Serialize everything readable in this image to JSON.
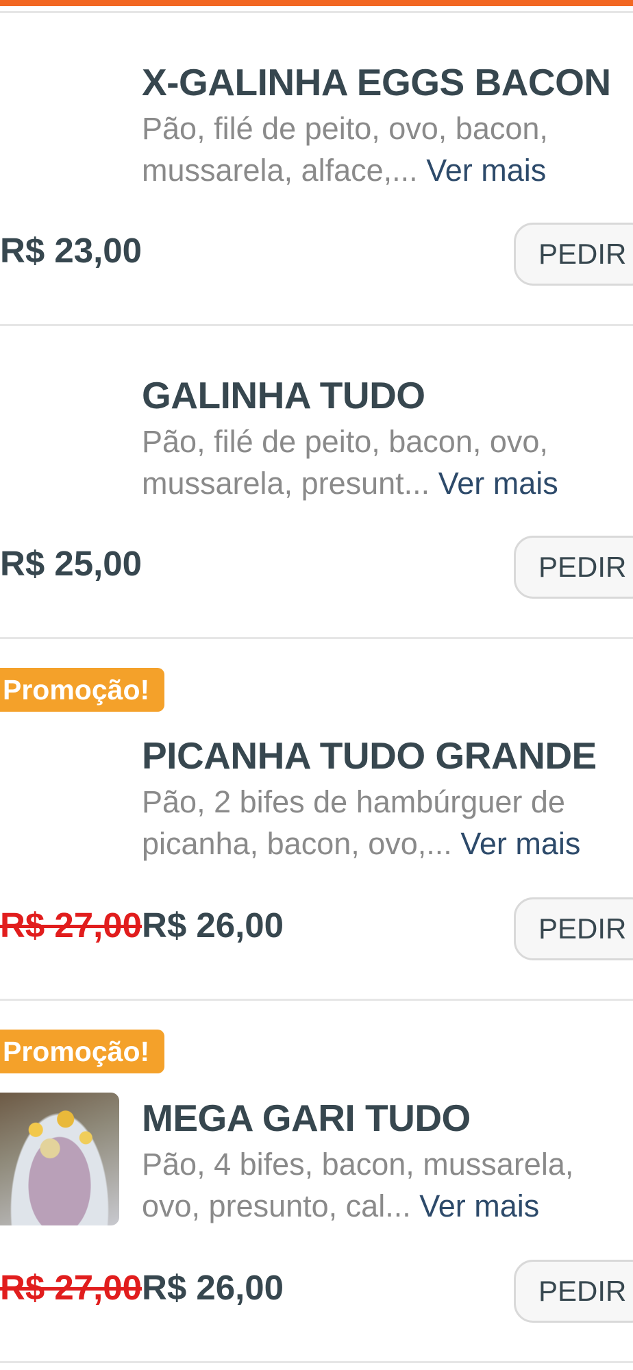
{
  "items": [
    {
      "title": "X-GALINHA EGGS BACON",
      "desc_line1": "Pão, filé de peito, ovo, bacon,",
      "desc_line2": "mussarela, alface,... ",
      "more": "Ver mais",
      "price": "R$ 23,00",
      "button": "PEDIR"
    },
    {
      "title": "GALINHA TUDO",
      "desc_line1": "Pão, filé de peito, bacon, ovo,",
      "desc_line2": "mussarela, presunt... ",
      "more": "Ver mais",
      "price": "R$ 25,00",
      "button": "PEDIR"
    },
    {
      "badge": "Promoção!",
      "title": "PICANHA TUDO GRANDE",
      "desc_line1": "Pão, 2 bifes de hambúrguer de",
      "desc_line2": "picanha, bacon, ovo,... ",
      "more": "Ver mais",
      "old_price": "R$ 27,00",
      "price": "R$ 26,00",
      "button": "PEDIR"
    },
    {
      "badge": "Promoção!",
      "title": "MEGA GARI TUDO",
      "desc_line1": "Pão, 4 bifes, bacon, mussarela,",
      "desc_line2": "ovo, presunto, cal... ",
      "more": "Ver mais",
      "old_price": "R$ 27,00",
      "price": "R$ 26,00",
      "button": "PEDIR"
    }
  ],
  "colors": {
    "accent": "#f26722",
    "badge": "#f4a12a",
    "title": "#37474f",
    "description": "#8a8a8a",
    "link": "#2d4a6a",
    "old_price": "#e11d1d"
  }
}
